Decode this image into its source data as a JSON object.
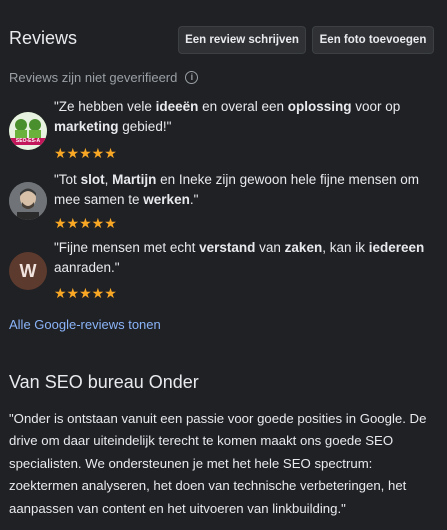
{
  "reviews_section": {
    "title": "Reviews",
    "write_review_button": "Een review schrijven",
    "add_photo_button": "Een foto toevoegen",
    "unverified_note": "Reviews zijn niet geverifieerd",
    "info_icon": "info-icon",
    "star_color": "#f9a825",
    "reviews": [
      {
        "avatar_label": "SEO-ES-A",
        "parts": [
          "\"Ze hebben vele ",
          "ideeën",
          " en overal een ",
          "oplossing",
          " voor op ",
          "marketing",
          " gebied!\""
        ],
        "rating": 5,
        "stars": "★★★★★"
      },
      {
        "avatar_label": "",
        "parts": [
          "\"Tot ",
          "slot",
          ", ",
          "Martijn",
          " en Ineke zijn gewoon hele fijne mensen om mee samen te ",
          "werken",
          ".\""
        ],
        "rating": 5,
        "stars": "★★★★★"
      },
      {
        "avatar_label": "W",
        "parts": [
          "\"Fijne mensen met echt ",
          "verstand",
          " van ",
          "zaken",
          ", kan ik ",
          "iedereen",
          " aanraden.\""
        ],
        "rating": 5,
        "stars": "★★★★★"
      }
    ],
    "all_reviews_link": "Alle Google-reviews tonen"
  },
  "about_section": {
    "title": "Van SEO bureau Onder",
    "description": "\"Onder is ontstaan vanuit een passie voor goede posities in Google. De drive om daar uiteindelijk terecht te komen maakt ons goede SEO specialisten. We ondersteunen je met het hele SEO spectrum: zoektermen analyseren, het doen van technische verbeteringen, het aanpassen van content en het uitvoeren van linkbuilding.\""
  }
}
